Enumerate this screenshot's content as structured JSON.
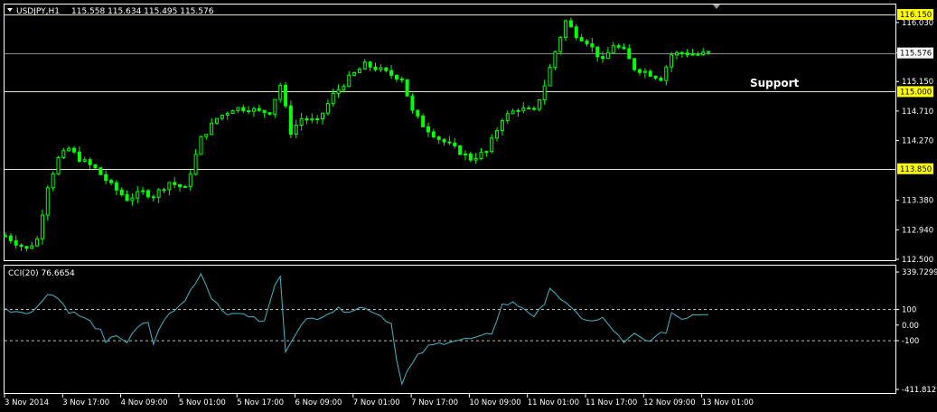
{
  "header": {
    "symbol_label": "USDJPY,H1",
    "ohlc": "115.558 115.634 115.495 115.576"
  },
  "colors": {
    "background": "#000000",
    "candle": "#00ff00",
    "grid_frame": "#ffffff",
    "level_line": "#e6e6c8",
    "level_badge": "#ffff00",
    "cci_line": "#3fb8c8"
  },
  "chart_data": [
    {
      "type": "candlestick",
      "title": "USDJPY,H1",
      "ylim": [
        112.5,
        116.15
      ],
      "y_ticks": [
        "116.030",
        "115.576",
        "115.150",
        "114.710",
        "114.270",
        "113.380",
        "112.940",
        "112.500"
      ],
      "x_ticks": [
        "3 Nov 2014",
        "3 Nov 17:00",
        "4 Nov 09:00",
        "5 Nov 01:00",
        "5 Nov 17:00",
        "6 Nov 09:00",
        "7 Nov 01:00",
        "7 Nov 17:00",
        "10 Nov 09:00",
        "11 Nov 01:00",
        "11 Nov 17:00",
        "12 Nov 09:00",
        "13 Nov 01:00"
      ],
      "levels": [
        {
          "value": 116.15,
          "label": "116.150"
        },
        {
          "value": 115.0,
          "label": "115.000"
        },
        {
          "value": 113.85,
          "label": "113.850"
        }
      ],
      "current_price": {
        "value": 115.576,
        "label": "115.576"
      },
      "annotation": "Support",
      "close_path": [
        [
          0,
          112.85
        ],
        [
          4,
          112.65
        ],
        [
          6,
          112.8
        ],
        [
          8,
          113.6
        ],
        [
          10,
          114.0
        ],
        [
          12,
          114.15
        ],
        [
          14,
          114.0
        ],
        [
          17,
          113.85
        ],
        [
          20,
          113.6
        ],
        [
          23,
          113.4
        ],
        [
          26,
          113.5
        ],
        [
          28,
          113.45
        ],
        [
          31,
          113.65
        ],
        [
          34,
          113.55
        ],
        [
          37,
          114.3
        ],
        [
          40,
          114.6
        ],
        [
          43,
          114.75
        ],
        [
          46,
          114.75
        ],
        [
          48,
          114.7
        ],
        [
          50,
          114.7
        ],
        [
          52,
          115.1
        ],
        [
          54,
          114.4
        ],
        [
          56,
          114.6
        ],
        [
          59,
          114.55
        ],
        [
          62,
          114.95
        ],
        [
          65,
          115.2
        ],
        [
          68,
          115.4
        ],
        [
          70,
          115.35
        ],
        [
          73,
          115.25
        ],
        [
          75,
          115.2
        ],
        [
          77,
          114.7
        ],
        [
          79,
          114.5
        ],
        [
          82,
          114.3
        ],
        [
          85,
          114.15
        ],
        [
          88,
          114.0
        ],
        [
          91,
          114.1
        ],
        [
          94,
          114.6
        ],
        [
          97,
          114.75
        ],
        [
          100,
          114.7
        ],
        [
          102,
          115.1
        ],
        [
          104,
          115.6
        ],
        [
          106,
          116.05
        ],
        [
          108,
          115.85
        ],
        [
          110,
          115.75
        ],
        [
          113,
          115.45
        ],
        [
          115,
          115.7
        ],
        [
          117,
          115.6
        ],
        [
          119,
          115.35
        ],
        [
          121,
          115.3
        ],
        [
          124,
          115.2
        ],
        [
          126,
          115.55
        ],
        [
          128,
          115.58
        ],
        [
          131,
          115.55
        ],
        [
          133,
          115.576
        ]
      ],
      "n_candles": 134
    },
    {
      "type": "line",
      "title": "CCI(20) 76.6654",
      "ylim": [
        -411.8129,
        339.7299
      ],
      "y_ticks": [
        "339.7299",
        "100",
        "0.00",
        "-100",
        "-411.8129"
      ],
      "levels": [
        100,
        -100
      ],
      "last_value": 76.6654,
      "series": [
        {
          "values": [
            [
              0,
              100
            ],
            [
              2,
              90
            ],
            [
              5,
              85
            ],
            [
              6,
              110
            ],
            [
              8,
              210
            ],
            [
              10,
              170
            ],
            [
              12,
              90
            ],
            [
              14,
              60
            ],
            [
              16,
              20
            ],
            [
              18,
              -40
            ],
            [
              19,
              -120
            ],
            [
              21,
              -60
            ],
            [
              23,
              -110
            ],
            [
              25,
              -20
            ],
            [
              27,
              20
            ],
            [
              28,
              -120
            ],
            [
              30,
              40
            ],
            [
              32,
              90
            ],
            [
              34,
              160
            ],
            [
              36,
              280
            ],
            [
              37,
              330
            ],
            [
              39,
              180
            ],
            [
              41,
              100
            ],
            [
              43,
              60
            ],
            [
              45,
              80
            ],
            [
              47,
              40
            ],
            [
              49,
              20
            ],
            [
              51,
              260
            ],
            [
              52,
              300
            ],
            [
              53,
              -160
            ],
            [
              55,
              -40
            ],
            [
              57,
              30
            ],
            [
              59,
              50
            ],
            [
              61,
              80
            ],
            [
              63,
              100
            ],
            [
              65,
              95
            ],
            [
              67,
              110
            ],
            [
              69,
              100
            ],
            [
              71,
              60
            ],
            [
              73,
              10
            ],
            [
              74,
              -210
            ],
            [
              75,
              -380
            ],
            [
              76,
              -300
            ],
            [
              78,
              -200
            ],
            [
              80,
              -140
            ],
            [
              82,
              -120
            ],
            [
              84,
              -100
            ],
            [
              86,
              -95
            ],
            [
              88,
              -90
            ],
            [
              90,
              -80
            ],
            [
              92,
              -50
            ],
            [
              94,
              130
            ],
            [
              96,
              140
            ],
            [
              98,
              110
            ],
            [
              100,
              60
            ],
            [
              102,
              120
            ],
            [
              103,
              250
            ],
            [
              105,
              170
            ],
            [
              107,
              100
            ],
            [
              109,
              50
            ],
            [
              111,
              20
            ],
            [
              113,
              40
            ],
            [
              115,
              -30
            ],
            [
              117,
              -120
            ],
            [
              119,
              -60
            ],
            [
              121,
              -100
            ],
            [
              123,
              -80
            ],
            [
              125,
              -40
            ],
            [
              126,
              80
            ],
            [
              128,
              40
            ],
            [
              130,
              70
            ],
            [
              133,
              76.6654
            ]
          ]
        }
      ]
    }
  ]
}
